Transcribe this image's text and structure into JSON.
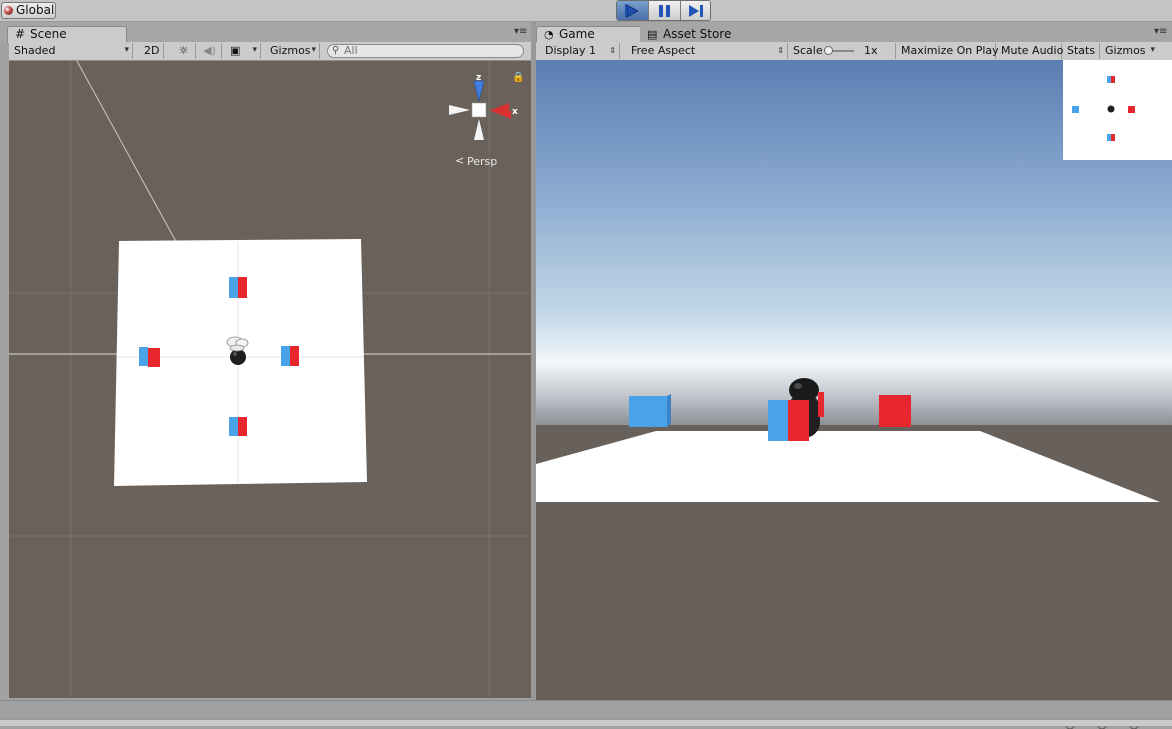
{
  "toolbar": {
    "global_label": "Global"
  },
  "scene_panel": {
    "tab_label": "Scene",
    "shading_mode": "Shaded",
    "mode_2d": "2D",
    "gizmos_label": "Gizmos",
    "search_placeholder": "All",
    "persp_label": "Persp",
    "axis_z": "z",
    "axis_x": "x"
  },
  "game_panel": {
    "tab_label": "Game",
    "asset_store_tab": "Asset Store",
    "display": "Display 1",
    "aspect": "Free Aspect",
    "scale_label": "Scale",
    "scale_value": "1x",
    "maximize_on_play": "Maximize On Play",
    "mute_audio": "Mute Audio",
    "stats": "Stats",
    "gizmos_label": "Gizmos"
  },
  "colors": {
    "cube_blue": "#4aa3e8",
    "cube_red": "#e8262e",
    "ground": "#ffffff",
    "play_active": "#4a6fa8",
    "unity_bg": "#6a625a"
  }
}
